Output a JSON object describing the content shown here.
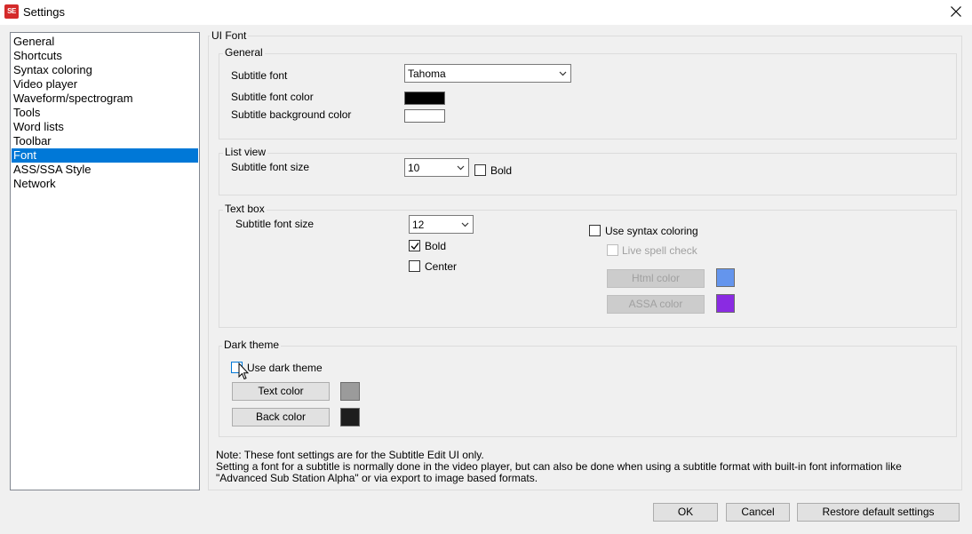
{
  "window": {
    "title": "Settings",
    "icon_text": "SE"
  },
  "nav": {
    "items": [
      {
        "label": "General"
      },
      {
        "label": "Shortcuts"
      },
      {
        "label": "Syntax coloring"
      },
      {
        "label": "Video player"
      },
      {
        "label": "Waveform/spectrogram"
      },
      {
        "label": "Tools"
      },
      {
        "label": "Word lists"
      },
      {
        "label": "Toolbar"
      },
      {
        "label": "Font",
        "selected": true
      },
      {
        "label": "ASS/SSA Style"
      },
      {
        "label": "Network"
      }
    ]
  },
  "ui_font": {
    "title": "UI Font",
    "general": {
      "title": "General",
      "subtitle_font_label": "Subtitle font",
      "subtitle_font_value": "Tahoma",
      "font_color_label": "Subtitle font color",
      "font_color": "#000000",
      "bg_color_label": "Subtitle background color",
      "bg_color": "#ffffff"
    },
    "list_view": {
      "title": "List view",
      "font_size_label": "Subtitle font size",
      "font_size_value": "10",
      "bold_label": "Bold",
      "bold_checked": false
    },
    "text_box": {
      "title": "Text box",
      "font_size_label": "Subtitle font size",
      "font_size_value": "12",
      "bold_label": "Bold",
      "bold_checked": true,
      "center_label": "Center",
      "center_checked": false,
      "syntax_label": "Use syntax coloring",
      "syntax_checked": false,
      "spell_label": "Live spell check",
      "spell_checked": false,
      "html_color_label": "Html color",
      "html_color": "#6495ed",
      "assa_color_label": "ASSA color",
      "assa_color": "#8a2be2"
    },
    "dark_theme": {
      "title": "Dark theme",
      "use_label": "Use dark theme",
      "use_checked": false,
      "text_color_label": "Text color",
      "text_color": "#9b9b9b",
      "back_color_label": "Back color",
      "back_color": "#1e1e1e"
    },
    "note": {
      "line1": "Note: These font settings are for the Subtitle Edit UI only.",
      "line2": "Setting a font for a subtitle is normally done in the video player, but can also be done when using a subtitle format with built-in font information like",
      "line3": "\"Advanced Sub Station Alpha\" or via export to image based formats."
    }
  },
  "footer": {
    "ok_label": "OK",
    "cancel_label": "Cancel",
    "restore_label": "Restore default settings"
  },
  "icons": {
    "close": "close-icon",
    "dropdown": "chevron-down-icon",
    "check": "checkmark-icon",
    "cursor": "mouse-pointer-icon"
  }
}
